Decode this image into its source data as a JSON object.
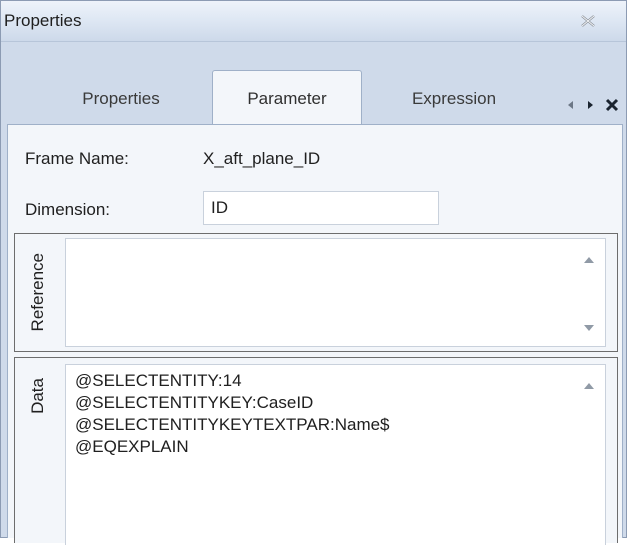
{
  "window": {
    "title": "Properties"
  },
  "tabs": [
    {
      "label": "Properties",
      "active": false
    },
    {
      "label": "Parameter",
      "active": true
    },
    {
      "label": "Expression",
      "active": false
    }
  ],
  "tab_nav": {
    "prev_icon": "triangle-left-icon",
    "next_icon": "triangle-right-icon",
    "close_icon": "close-icon"
  },
  "form": {
    "frame_name_label": "Frame Name:",
    "frame_name_value": "X_aft_plane_ID",
    "dimension_label": "Dimension:",
    "dimension_value": "ID"
  },
  "reference_box": {
    "label": "Reference",
    "content": ""
  },
  "data_box": {
    "label": "Data",
    "lines": [
      "@SELECTENTITY:14",
      "@SELECTENTITYKEY:CaseID",
      "@SELECTENTITYKEYTEXTPAR:Name$",
      "@EQEXPLAIN"
    ]
  },
  "colors": {
    "window_background": "#cfdaea",
    "panel_background": "#f3f6fa",
    "border": "#9fb0c8"
  }
}
